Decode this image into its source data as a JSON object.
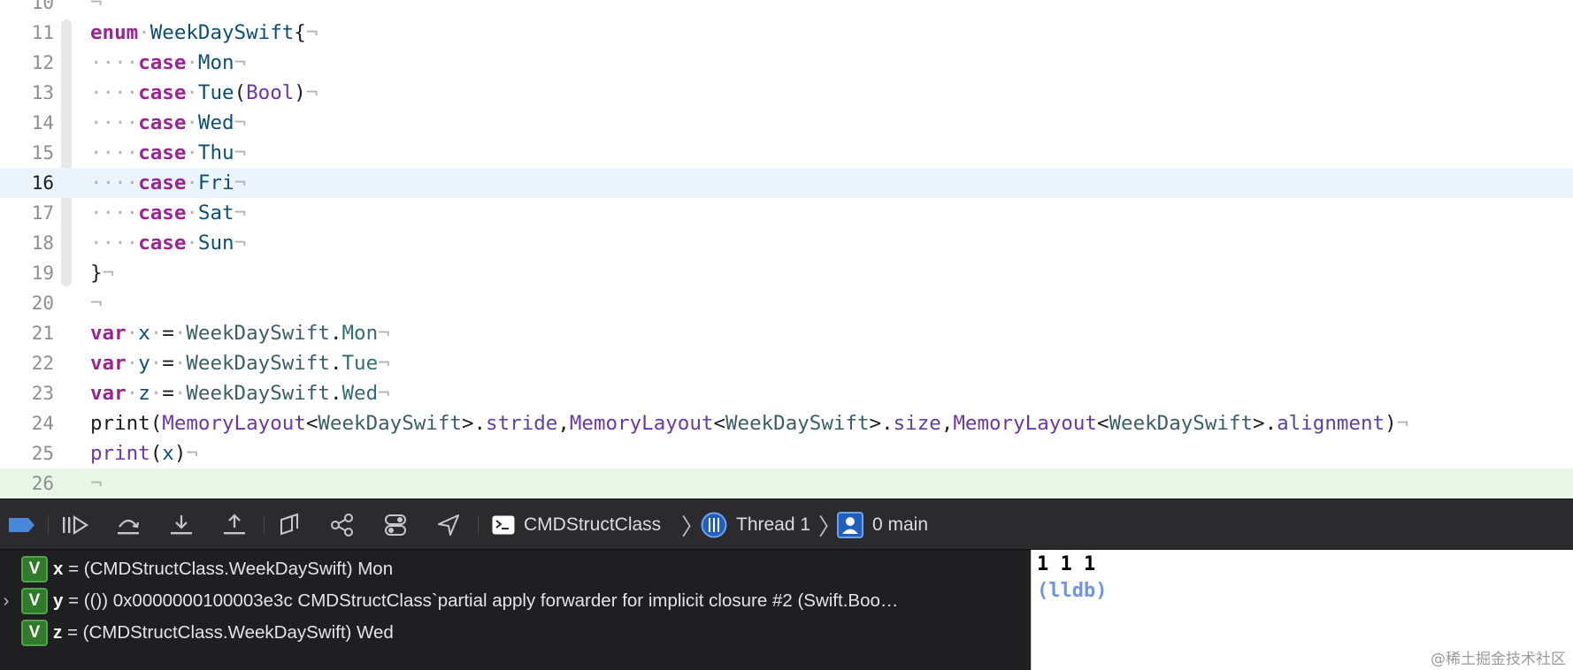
{
  "editor": {
    "lines": [
      {
        "num": "10",
        "state": "",
        "tokens": [
          {
            "t": "¬",
            "c": "tok-nl"
          }
        ]
      },
      {
        "num": "11",
        "state": "",
        "tokens": [
          {
            "t": "enum",
            "c": "tok-kw"
          },
          {
            "t": "·",
            "c": "tok-ws"
          },
          {
            "t": "WeekDaySwift",
            "c": "tok-type2"
          },
          {
            "t": "{",
            "c": "tok-plain"
          },
          {
            "t": "¬",
            "c": "tok-nl"
          }
        ]
      },
      {
        "num": "12",
        "state": "",
        "tokens": [
          {
            "t": "····",
            "c": "tok-ws"
          },
          {
            "t": "case",
            "c": "tok-kw"
          },
          {
            "t": "·",
            "c": "tok-ws"
          },
          {
            "t": "Mon",
            "c": "tok-type2"
          },
          {
            "t": "¬",
            "c": "tok-nl"
          }
        ]
      },
      {
        "num": "13",
        "state": "",
        "tokens": [
          {
            "t": "····",
            "c": "tok-ws"
          },
          {
            "t": "case",
            "c": "tok-kw"
          },
          {
            "t": "·",
            "c": "tok-ws"
          },
          {
            "t": "Tue",
            "c": "tok-type2"
          },
          {
            "t": "(",
            "c": "tok-plain"
          },
          {
            "t": "Bool",
            "c": "tok-builtin"
          },
          {
            "t": ")",
            "c": "tok-plain"
          },
          {
            "t": "¬",
            "c": "tok-nl"
          }
        ]
      },
      {
        "num": "14",
        "state": "",
        "tokens": [
          {
            "t": "····",
            "c": "tok-ws"
          },
          {
            "t": "case",
            "c": "tok-kw"
          },
          {
            "t": "·",
            "c": "tok-ws"
          },
          {
            "t": "Wed",
            "c": "tok-type2"
          },
          {
            "t": "¬",
            "c": "tok-nl"
          }
        ]
      },
      {
        "num": "15",
        "state": "",
        "tokens": [
          {
            "t": "····",
            "c": "tok-ws"
          },
          {
            "t": "case",
            "c": "tok-kw"
          },
          {
            "t": "·",
            "c": "tok-ws"
          },
          {
            "t": "Thu",
            "c": "tok-type2"
          },
          {
            "t": "¬",
            "c": "tok-nl"
          }
        ]
      },
      {
        "num": "16",
        "state": "current",
        "tokens": [
          {
            "t": "····",
            "c": "tok-ws"
          },
          {
            "t": "case",
            "c": "tok-kw"
          },
          {
            "t": "·",
            "c": "tok-ws"
          },
          {
            "t": "Fri",
            "c": "tok-type2"
          },
          {
            "t": "¬",
            "c": "tok-nl"
          }
        ]
      },
      {
        "num": "17",
        "state": "",
        "tokens": [
          {
            "t": "····",
            "c": "tok-ws"
          },
          {
            "t": "case",
            "c": "tok-kw"
          },
          {
            "t": "·",
            "c": "tok-ws"
          },
          {
            "t": "Sat",
            "c": "tok-type2"
          },
          {
            "t": "¬",
            "c": "tok-nl"
          }
        ]
      },
      {
        "num": "18",
        "state": "",
        "tokens": [
          {
            "t": "····",
            "c": "tok-ws"
          },
          {
            "t": "case",
            "c": "tok-kw"
          },
          {
            "t": "·",
            "c": "tok-ws"
          },
          {
            "t": "Sun",
            "c": "tok-type2"
          },
          {
            "t": "¬",
            "c": "tok-nl"
          }
        ]
      },
      {
        "num": "19",
        "state": "",
        "tokens": [
          {
            "t": "}",
            "c": "tok-plain"
          },
          {
            "t": "¬",
            "c": "tok-nl"
          }
        ]
      },
      {
        "num": "20",
        "state": "",
        "tokens": [
          {
            "t": "¬",
            "c": "tok-nl"
          }
        ]
      },
      {
        "num": "21",
        "state": "",
        "tokens": [
          {
            "t": "var",
            "c": "tok-kw"
          },
          {
            "t": "·",
            "c": "tok-ws"
          },
          {
            "t": "x",
            "c": "tok-type2"
          },
          {
            "t": "·",
            "c": "tok-ws"
          },
          {
            "t": "=",
            "c": "tok-plain"
          },
          {
            "t": "·",
            "c": "tok-ws"
          },
          {
            "t": "WeekDaySwift",
            "c": "tok-type"
          },
          {
            "t": ".",
            "c": "tok-plain"
          },
          {
            "t": "Mon",
            "c": "tok-member"
          },
          {
            "t": "¬",
            "c": "tok-nl"
          }
        ]
      },
      {
        "num": "22",
        "state": "",
        "tokens": [
          {
            "t": "var",
            "c": "tok-kw"
          },
          {
            "t": "·",
            "c": "tok-ws"
          },
          {
            "t": "y",
            "c": "tok-type2"
          },
          {
            "t": "·",
            "c": "tok-ws"
          },
          {
            "t": "=",
            "c": "tok-plain"
          },
          {
            "t": "·",
            "c": "tok-ws"
          },
          {
            "t": "WeekDaySwift",
            "c": "tok-type"
          },
          {
            "t": ".",
            "c": "tok-plain"
          },
          {
            "t": "Tue",
            "c": "tok-member"
          },
          {
            "t": "¬",
            "c": "tok-nl"
          }
        ]
      },
      {
        "num": "23",
        "state": "",
        "tokens": [
          {
            "t": "var",
            "c": "tok-kw"
          },
          {
            "t": "·",
            "c": "tok-ws"
          },
          {
            "t": "z",
            "c": "tok-type2"
          },
          {
            "t": "·",
            "c": "tok-ws"
          },
          {
            "t": "=",
            "c": "tok-plain"
          },
          {
            "t": "·",
            "c": "tok-ws"
          },
          {
            "t": "WeekDaySwift",
            "c": "tok-type"
          },
          {
            "t": ".",
            "c": "tok-plain"
          },
          {
            "t": "Wed",
            "c": "tok-member"
          },
          {
            "t": "¬",
            "c": "tok-nl"
          }
        ]
      },
      {
        "num": "24",
        "state": "",
        "tokens": [
          {
            "t": "print(",
            "c": "tok-plain"
          },
          {
            "t": "MemoryLayout",
            "c": "tok-builtin"
          },
          {
            "t": "<",
            "c": "tok-plain"
          },
          {
            "t": "WeekDaySwift",
            "c": "tok-type"
          },
          {
            "t": ">.",
            "c": "tok-plain"
          },
          {
            "t": "stride",
            "c": "tok-prop"
          },
          {
            "t": ",",
            "c": "tok-plain"
          },
          {
            "t": "MemoryLayout",
            "c": "tok-builtin"
          },
          {
            "t": "<",
            "c": "tok-plain"
          },
          {
            "t": "WeekDaySwift",
            "c": "tok-type"
          },
          {
            "t": ">.",
            "c": "tok-plain"
          },
          {
            "t": "size",
            "c": "tok-prop"
          },
          {
            "t": ",",
            "c": "tok-plain"
          },
          {
            "t": "MemoryLayout",
            "c": "tok-builtin"
          },
          {
            "t": "<",
            "c": "tok-plain"
          },
          {
            "t": "WeekDaySwift",
            "c": "tok-type"
          },
          {
            "t": ">.",
            "c": "tok-plain"
          },
          {
            "t": "alignment",
            "c": "tok-prop"
          },
          {
            "t": ")",
            "c": "tok-plain"
          },
          {
            "t": "¬",
            "c": "tok-nl"
          }
        ]
      },
      {
        "num": "25",
        "state": "",
        "tokens": [
          {
            "t": "print",
            "c": "tok-builtin"
          },
          {
            "t": "(",
            "c": "tok-plain"
          },
          {
            "t": "x",
            "c": "tok-type2"
          },
          {
            "t": ")",
            "c": "tok-plain"
          },
          {
            "t": "¬",
            "c": "tok-nl"
          }
        ]
      },
      {
        "num": "26",
        "state": "exec",
        "tokens": [
          {
            "t": "¬",
            "c": "tok-nl"
          }
        ]
      }
    ]
  },
  "debug_bar": {
    "buttons": [
      {
        "name": "breakpoints-toggle-icon"
      },
      {
        "name": "continue-icon"
      },
      {
        "name": "step-over-icon"
      },
      {
        "name": "step-into-icon"
      },
      {
        "name": "step-out-icon"
      },
      {
        "name": "debug-view-hierarchy-icon"
      },
      {
        "name": "memory-graph-icon"
      },
      {
        "name": "environment-overrides-icon"
      },
      {
        "name": "simulate-location-icon"
      }
    ],
    "breadcrumb": {
      "target": "CMDStructClass",
      "thread": "Thread 1",
      "frame": "0 main"
    }
  },
  "variables": [
    {
      "badge": "V",
      "name": "x",
      "value": " = (CMDStructClass.WeekDaySwift) Mon",
      "expandable": false
    },
    {
      "badge": "V",
      "name": "y",
      "value": " = (()) 0x0000000100003e3c CMDStructClass`partial apply forwarder for implicit closure #2 (Swift.Boo…",
      "expandable": true
    },
    {
      "badge": "V",
      "name": "z",
      "value": " = (CMDStructClass.WeekDaySwift) Wed",
      "expandable": false
    }
  ],
  "console": {
    "output": "1 1 1",
    "prompt": "(lldb)",
    "watermark": "@稀土掘金技术社区"
  }
}
